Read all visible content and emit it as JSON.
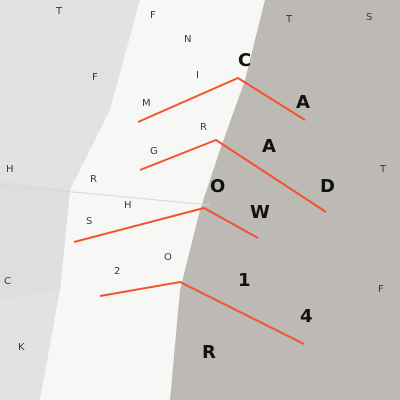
{
  "colors": {
    "paper_light": "#f4f4f3",
    "paper_shadow": "#dcdcda",
    "paper_gray": "#bab7b3",
    "accent_line": "#f2532d"
  },
  "letters": {
    "scatter_T_top": "T",
    "scatter_T_right": "T",
    "scatter_S": "S",
    "scatter_F_left": "F",
    "scatter_H": "H",
    "scatter_Ttop2": "T",
    "scatter_F_right": "F",
    "scatter_C": "C",
    "scatter_K": "K",
    "pale_F": "F",
    "pale_N": "N",
    "pale_I": "I",
    "pale_M": "M",
    "pale_G": "G",
    "pale_R": "R",
    "pale_R2": "R",
    "pale_H": "H",
    "pale_S": "S",
    "pale_2": "2",
    "pale_O": "O",
    "dark_C": "C",
    "dark_A": "A",
    "dark_A2": "A",
    "dark_D": "D",
    "dark_O": "O",
    "dark_W": "W",
    "dark_1": "1",
    "dark_4": "4",
    "dark_R": "R"
  }
}
